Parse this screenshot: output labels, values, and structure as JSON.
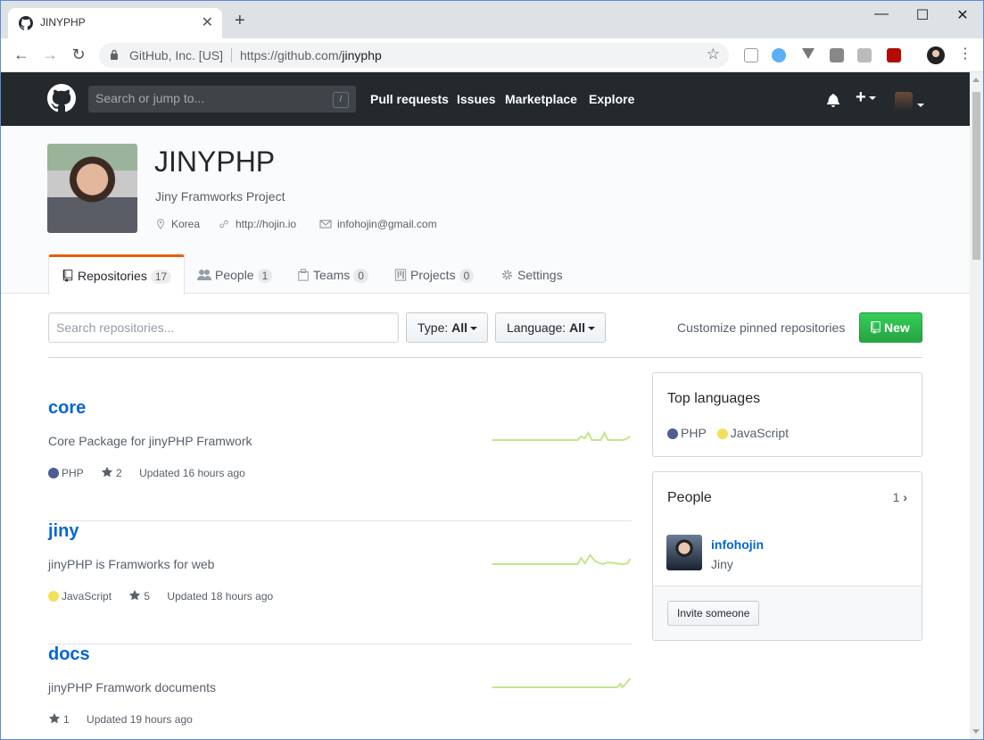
{
  "browser": {
    "tab_title": "JINYPHP",
    "site_org": "GitHub, Inc. [US]",
    "url_prefix": "https://github.com/",
    "url_path": "jinyphp"
  },
  "header": {
    "search_placeholder": "Search or jump to...",
    "search_shortcut": "/",
    "nav": [
      "Pull requests",
      "Issues",
      "Marketplace",
      "Explore"
    ]
  },
  "org": {
    "name": "JINYPHP",
    "description": "Jiny Framworks Project",
    "location": "Korea",
    "website": "http://hojin.io",
    "email": "infohojin@gmail.com"
  },
  "tabs": [
    {
      "label": "Repositories",
      "count": "17"
    },
    {
      "label": "People",
      "count": "1"
    },
    {
      "label": "Teams",
      "count": "0"
    },
    {
      "label": "Projects",
      "count": "0"
    },
    {
      "label": "Settings",
      "count": ""
    }
  ],
  "filters": {
    "search_placeholder": "Search repositories...",
    "type_label": "Type:",
    "type_value": "All",
    "language_label": "Language:",
    "language_value": "All",
    "customize": "Customize pinned repositories",
    "new_button": "New"
  },
  "repos": [
    {
      "name": "core",
      "description": "Core Package for jinyPHP Framwork",
      "language": "PHP",
      "language_color": "#4F5D95",
      "stars": "2",
      "updated": "Updated 16 hours ago"
    },
    {
      "name": "jiny",
      "description": "jinyPHP is Framworks for web",
      "language": "JavaScript",
      "language_color": "#f1e05a",
      "stars": "5",
      "updated": "Updated 18 hours ago"
    },
    {
      "name": "docs",
      "description": "jinyPHP Framwork documents",
      "language": "",
      "language_color": "",
      "stars": "1",
      "updated": "Updated 19 hours ago"
    }
  ],
  "sidebar": {
    "top_languages_title": "Top languages",
    "languages": [
      {
        "name": "PHP",
        "color": "#4F5D95"
      },
      {
        "name": "JavaScript",
        "color": "#f1e05a"
      }
    ],
    "people_title": "People",
    "people_count": "1",
    "member_login": "infohojin",
    "member_name": "Jiny",
    "invite_button": "Invite someone"
  },
  "colors": {
    "header_bg": "#24292e",
    "link": "#0366d6",
    "selected_tab_accent": "#e36209",
    "new_button": "#28a745"
  }
}
